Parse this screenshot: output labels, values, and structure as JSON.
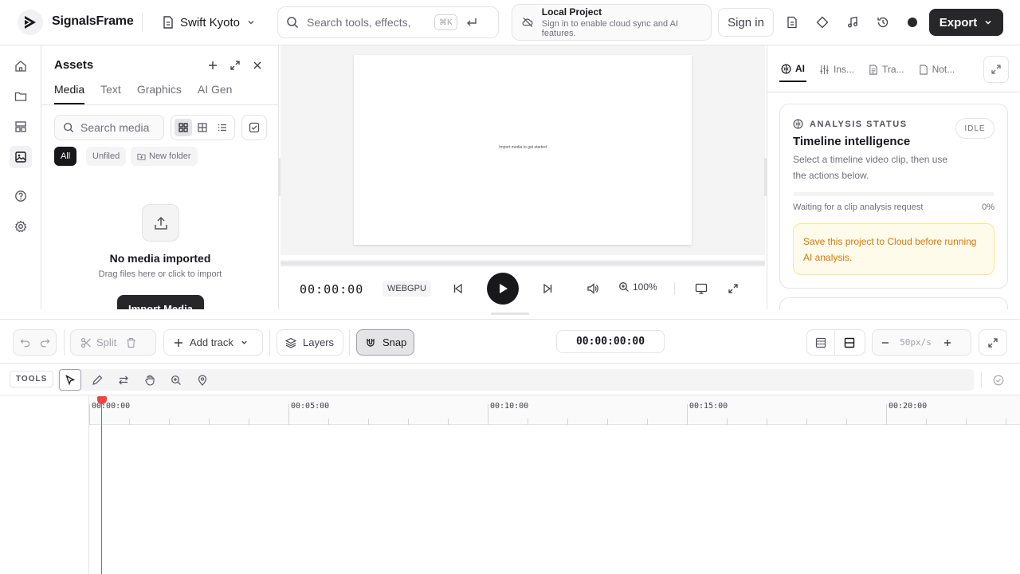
{
  "app": {
    "brand": "SignalsFrame",
    "project_name": "Swift Kyoto",
    "search_placeholder": "Search tools, effects,",
    "search_shortcut": "⌘K",
    "local_title": "Local Project",
    "local_sub": "Sign in to enable cloud sync and AI features.",
    "signin_label": "Sign in",
    "export_label": "Export"
  },
  "assets": {
    "title": "Assets",
    "tabs": [
      "Media",
      "Text",
      "Graphics",
      "AI Gen"
    ],
    "active_tab": "Media",
    "search_placeholder": "Search media",
    "filters": [
      "All",
      "Unfiled",
      "New folder"
    ],
    "empty_title": "No media imported",
    "empty_sub": "Drag files here or click to import",
    "import_label": "Import Media"
  },
  "preview": {
    "canvas_text": "Import media to get started",
    "timecode": "00:00:00",
    "renderer": "WEBGPU",
    "zoom": "100%"
  },
  "right": {
    "tabs": [
      "AI",
      "Ins...",
      "Tra...",
      "Not..."
    ],
    "active_tab": "AI",
    "card": {
      "heading": "ANALYSIS STATUS",
      "badge": "IDLE",
      "title": "Timeline intelligence",
      "desc": "Select a timeline video clip, then use the actions below.",
      "wait": "Waiting for a clip analysis request",
      "progress": "0%",
      "warn": "Save this project to Cloud before running AI analysis."
    }
  },
  "timeline": {
    "split_label": "Split",
    "add_track_label": "Add track",
    "layers_label": "Layers",
    "snap_label": "Snap",
    "timecode": "00:00:00:00",
    "zoom_rate": "50px/s",
    "tools_label": "TOOLS",
    "ruler_labels": [
      "00:00:00",
      "00:05:00",
      "00:10:00",
      "00:15:00",
      "00:20:00"
    ]
  }
}
